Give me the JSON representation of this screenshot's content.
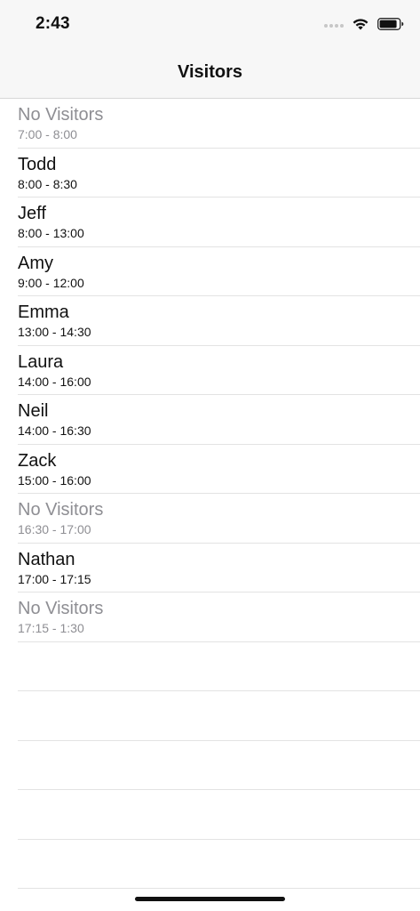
{
  "status_bar": {
    "time": "2:43",
    "icons": [
      "cellular-signal-icon",
      "wifi-icon",
      "battery-icon"
    ]
  },
  "nav": {
    "title": "Visitors"
  },
  "rows": [
    {
      "name": "No Visitors",
      "time": "7:00 - 8:00",
      "empty": true
    },
    {
      "name": "Todd",
      "time": "8:00 - 8:30",
      "empty": false
    },
    {
      "name": "Jeff",
      "time": "8:00 - 13:00",
      "empty": false
    },
    {
      "name": "Amy",
      "time": "9:00 - 12:00",
      "empty": false
    },
    {
      "name": "Emma",
      "time": "13:00 - 14:30",
      "empty": false
    },
    {
      "name": "Laura",
      "time": "14:00 - 16:00",
      "empty": false
    },
    {
      "name": "Neil",
      "time": "14:00 - 16:30",
      "empty": false
    },
    {
      "name": "Zack",
      "time": "15:00 - 16:00",
      "empty": false
    },
    {
      "name": "No Visitors",
      "time": "16:30 - 17:00",
      "empty": true
    },
    {
      "name": "Nathan",
      "time": "17:00 - 17:15",
      "empty": false
    },
    {
      "name": "No Visitors",
      "time": "17:15 - 1:30",
      "empty": true
    }
  ],
  "colors": {
    "primary_text": "#111111",
    "secondary_text": "#8e8e93",
    "nav_background": "#f7f7f7",
    "separator": "#e3e3e3"
  }
}
